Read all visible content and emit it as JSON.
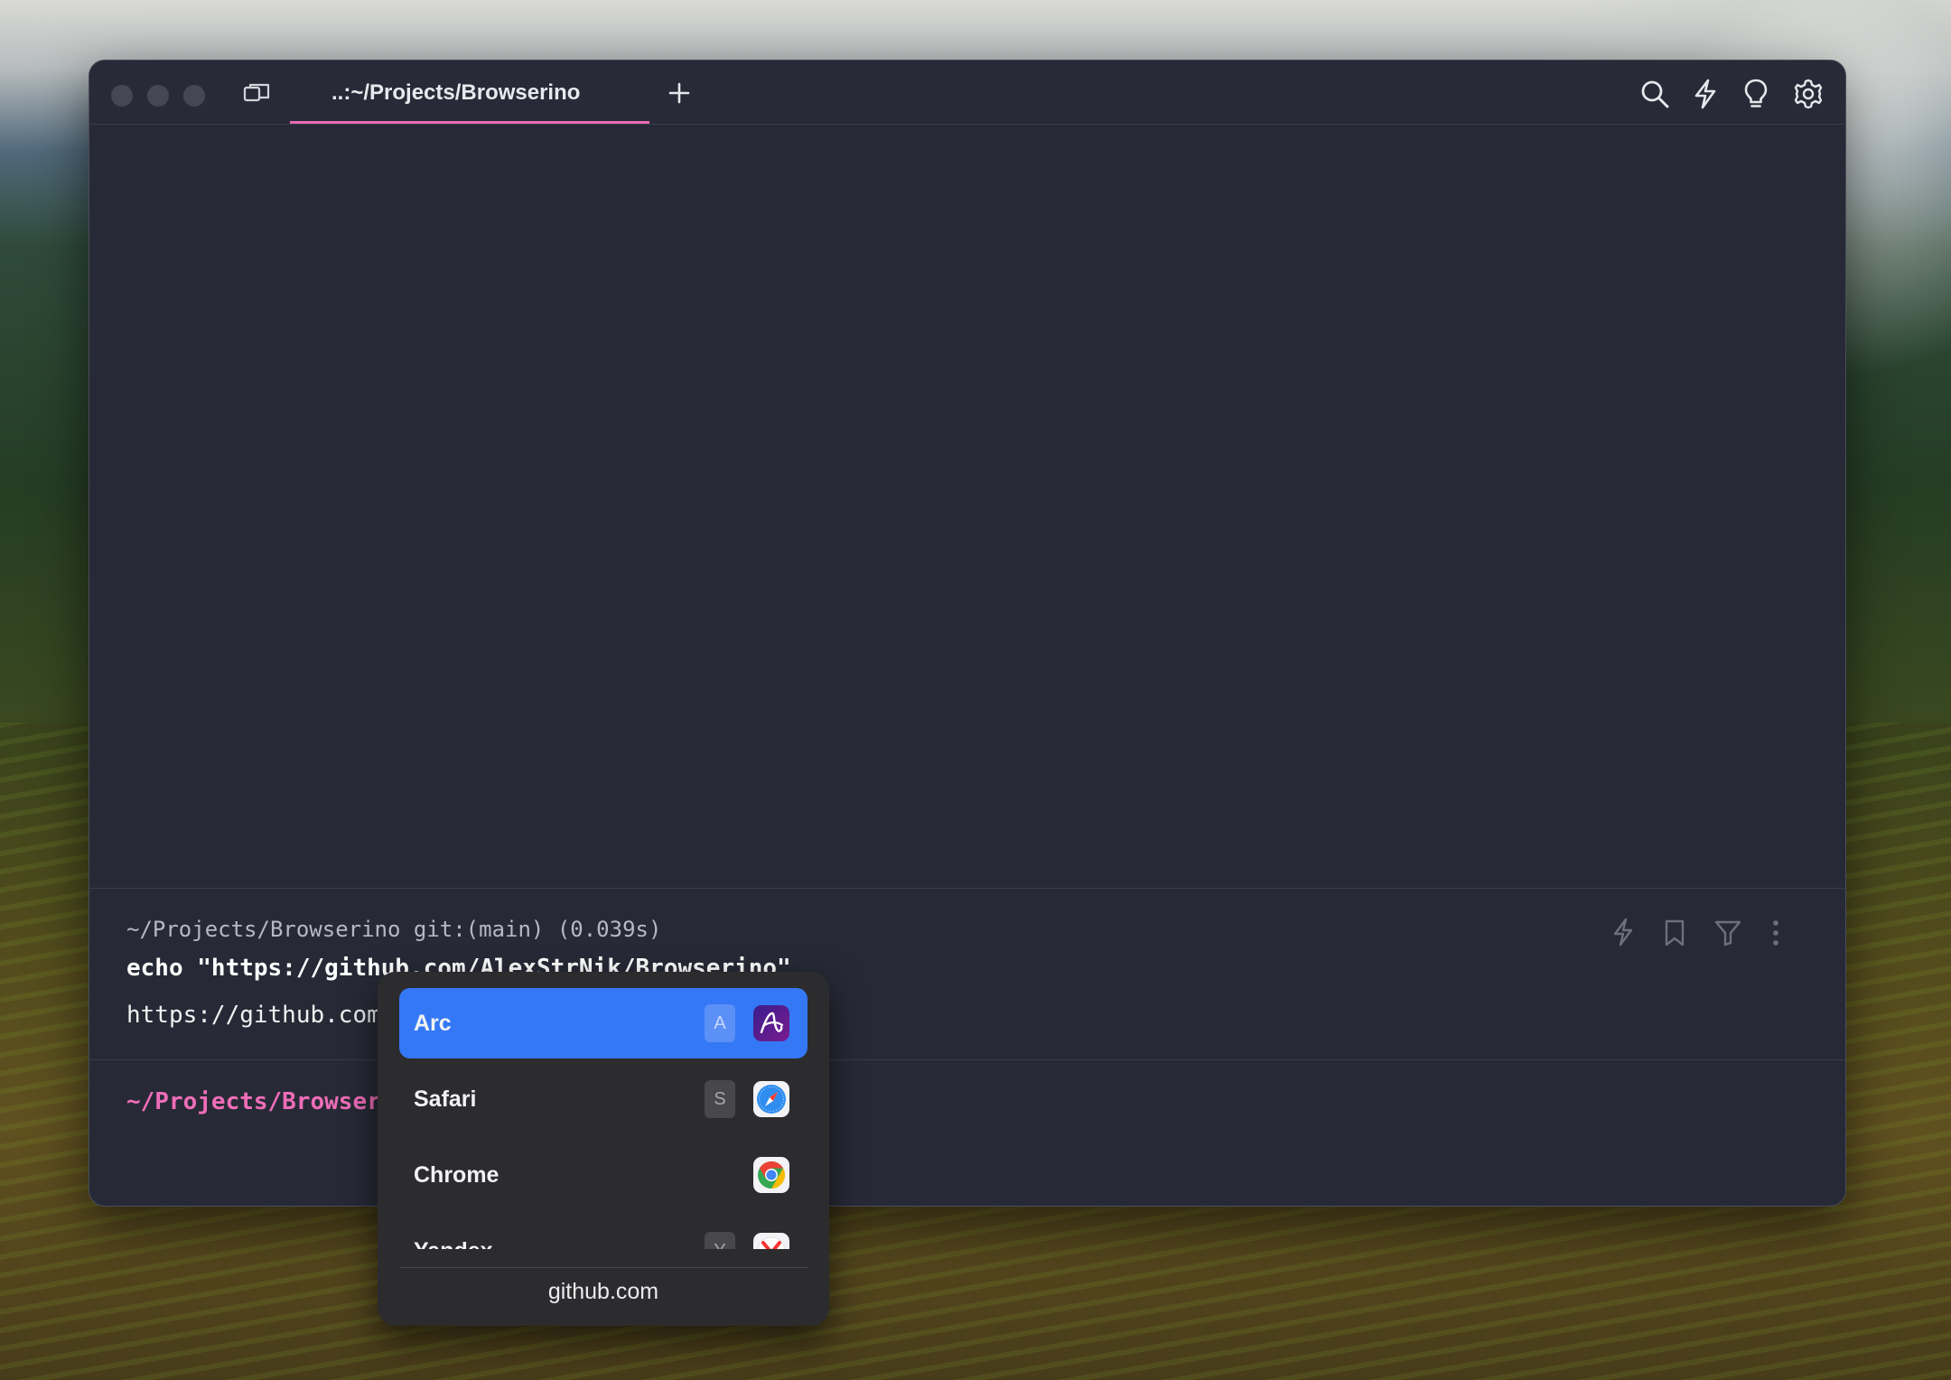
{
  "window": {
    "tab_title": "..:~/Projects/Browserino"
  },
  "block": {
    "header": "~/Projects/Browserino git:(main) (0.039s)",
    "command": "echo \"https://github.com/AlexStrNik/Browserino\"",
    "output": "https://github.com/AlexStrNik/Browserino",
    "prompt": "~/Projects/Browserino"
  },
  "picker": {
    "items": [
      {
        "label": "Arc",
        "key": "A",
        "icon": "arc-app-icon",
        "selected": true
      },
      {
        "label": "Safari",
        "key": "S",
        "icon": "safari-app-icon",
        "selected": false
      },
      {
        "label": "Chrome",
        "key": "",
        "icon": "chrome-app-icon",
        "selected": false
      },
      {
        "label": "Yandex",
        "key": "Y",
        "icon": "yandex-app-icon",
        "selected": false
      }
    ],
    "url": "github.com"
  },
  "colors": {
    "accent_pink": "#e56bb4",
    "selection_blue": "#3478f6",
    "terminal_bg": "#272a36"
  }
}
